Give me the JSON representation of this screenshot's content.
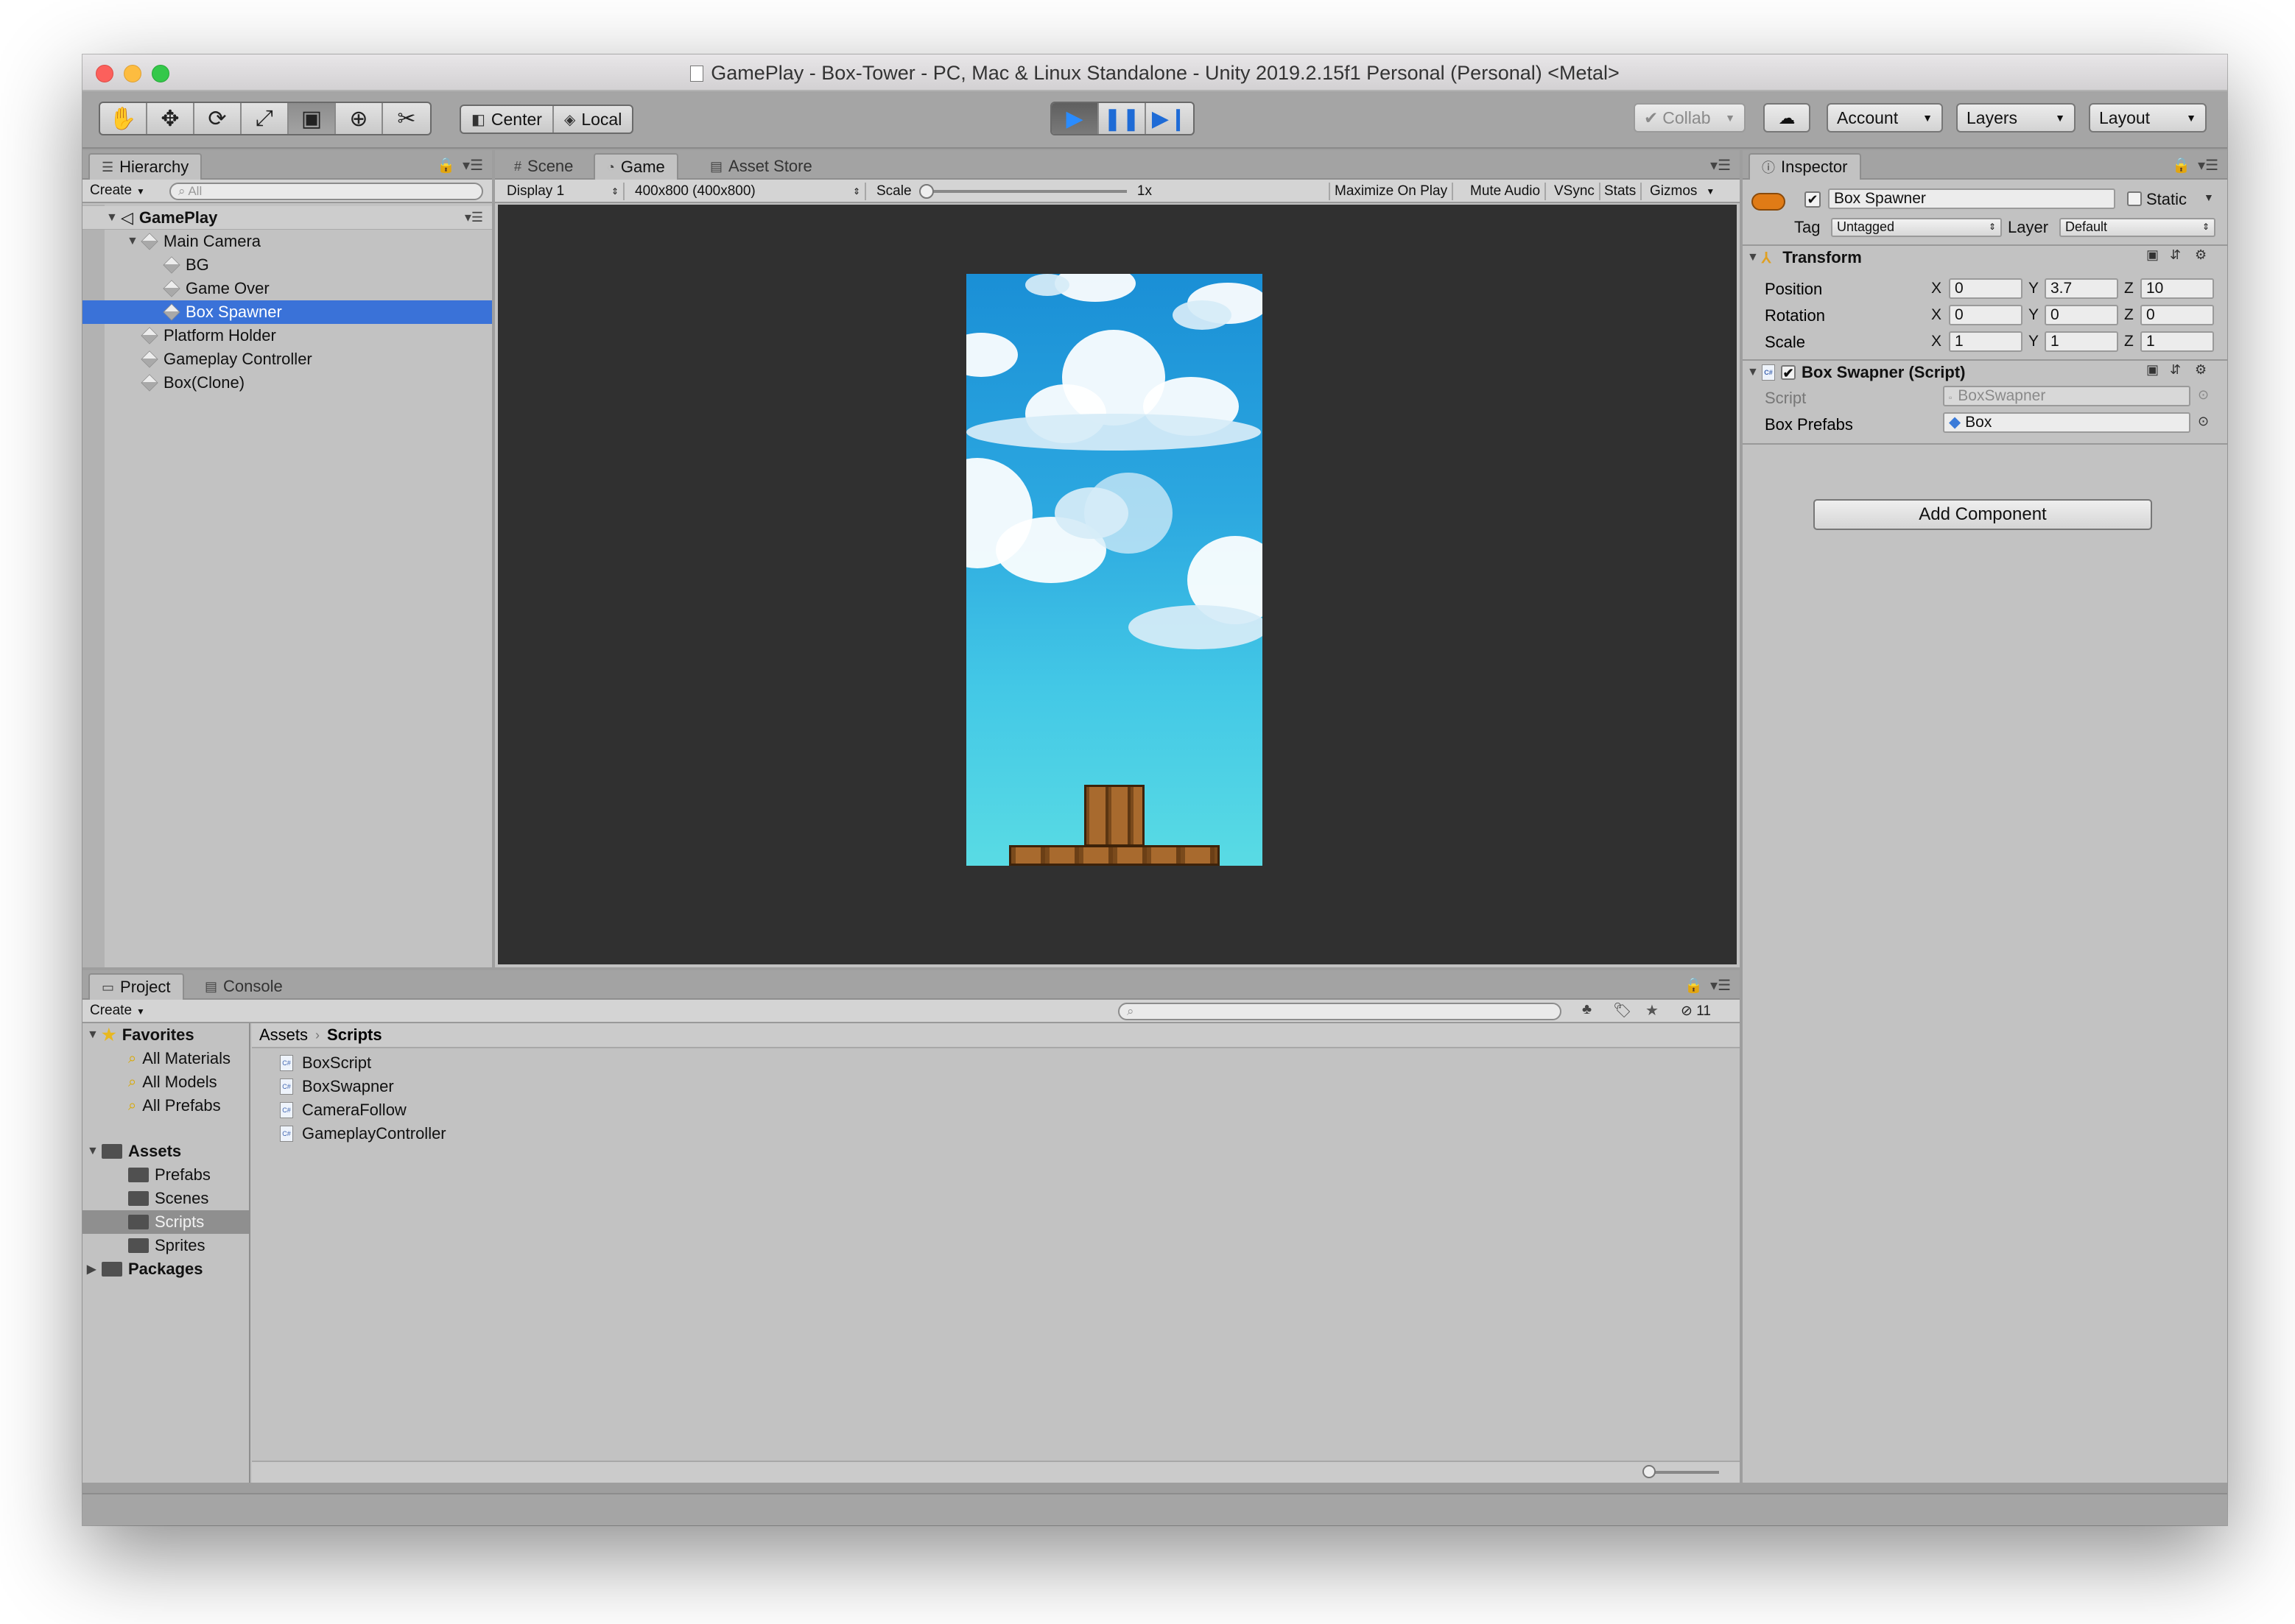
{
  "window": {
    "title": "GamePlay - Box-Tower - PC, Mac & Linux Standalone - Unity 2019.2.15f1 Personal (Personal) <Metal>"
  },
  "toolbar": {
    "tools": [
      "hand-tool",
      "move-tool",
      "rotate-tool",
      "scale-tool",
      "rect-tool",
      "transform-tool",
      "custom-tool"
    ],
    "pivot_center": "Center",
    "pivot_local": "Local",
    "collab": "Collab",
    "account": "Account",
    "layers": "Layers",
    "layout": "Layout"
  },
  "hierarchy": {
    "tab": "Hierarchy",
    "create": "Create",
    "search_placeholder": "All",
    "scene": "GamePlay",
    "items": [
      {
        "label": "Main Camera"
      },
      {
        "label": "BG"
      },
      {
        "label": "Game Over"
      },
      {
        "label": "Box Spawner"
      },
      {
        "label": "Platform Holder"
      },
      {
        "label": "Gameplay Controller"
      },
      {
        "label": "Box(Clone)"
      }
    ]
  },
  "game_view": {
    "tabs": [
      "Scene",
      "Game",
      "Asset Store"
    ],
    "display": "Display 1",
    "resolution": "400x800 (400x800)",
    "scale_label": "Scale",
    "scale_value": "1x",
    "options": [
      "Maximize On Play",
      "Mute Audio",
      "VSync",
      "Stats",
      "Gizmos"
    ]
  },
  "inspector": {
    "tab": "Inspector",
    "object_name": "Box Spawner",
    "static_label": "Static",
    "tag_label": "Tag",
    "tag_value": "Untagged",
    "layer_label": "Layer",
    "layer_value": "Default",
    "transform": {
      "title": "Transform",
      "position_label": "Position",
      "rotation_label": "Rotation",
      "scale_label": "Scale",
      "position": {
        "x": "0",
        "y": "3.7",
        "z": "10"
      },
      "rotation": {
        "x": "0",
        "y": "0",
        "z": "0"
      },
      "scale": {
        "x": "1",
        "y": "1",
        "z": "1"
      }
    },
    "script_component": {
      "title": "Box Swapner (Script)",
      "script_label": "Script",
      "script_value": "BoxSwapner",
      "prefabs_label": "Box Prefabs",
      "prefabs_value": "Box"
    },
    "add_component": "Add Component"
  },
  "project": {
    "tabs": [
      "Project",
      "Console"
    ],
    "create": "Create",
    "hidden_count": "11",
    "favorites": {
      "label": "Favorites",
      "items": [
        "All Materials",
        "All Models",
        "All Prefabs"
      ]
    },
    "assets": {
      "label": "Assets",
      "items": [
        "Prefabs",
        "Scenes",
        "Scripts",
        "Sprites"
      ]
    },
    "packages": "Packages",
    "breadcrumb": {
      "root": "Assets",
      "current": "Scripts"
    },
    "files": [
      "BoxScript",
      "BoxSwapner",
      "CameraFollow",
      "GameplayController"
    ]
  }
}
